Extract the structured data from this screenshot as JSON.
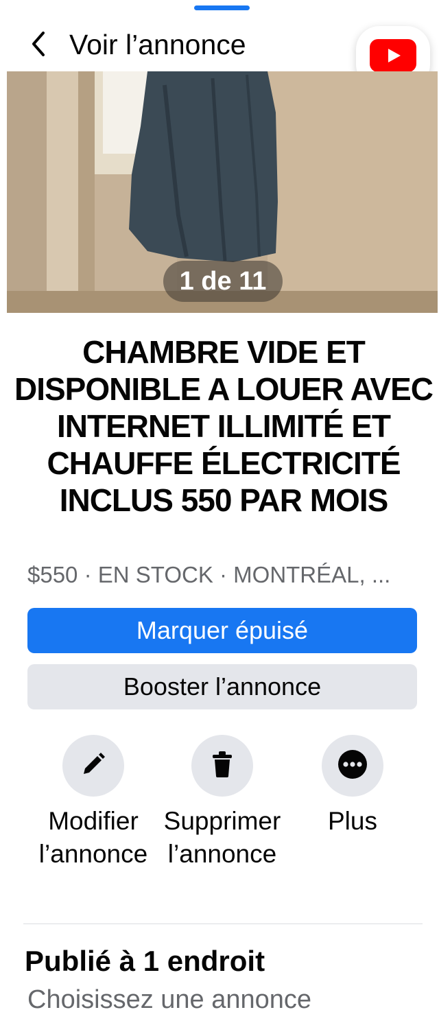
{
  "header": {
    "title": "Voir l’annonce",
    "back_icon": "chevron-left-icon",
    "floating_app_icon": "youtube-icon"
  },
  "photo": {
    "counter": "1 de 11"
  },
  "listing": {
    "title": "CHAMBRE VIDE ET DISPONIBLE A LOUER AVEC INTERNET ILLIMITÉ ET CHAUFFE ÉLECTRICITÉ INCLUS 550 PAR MOIS",
    "meta": "$550 · EN STOCK · MONTRÉAL, ..."
  },
  "buttons": {
    "mark_sold": "Marquer épuisé",
    "boost": "Booster l’annonce"
  },
  "actions": [
    {
      "label": "Modifier l’annonce",
      "icon": "pencil-icon"
    },
    {
      "label": "Supprimer l’annonce",
      "icon": "trash-icon"
    },
    {
      "label": "Plus",
      "icon": "more-icon"
    }
  ],
  "published": {
    "title": "Publié à 1 endroit",
    "subtitle": "Choisissez une annonce"
  },
  "colors": {
    "accent": "#1877f2",
    "secondary_button": "#e4e6eb",
    "muted_text": "#65676b",
    "youtube_red": "#ff0000"
  }
}
